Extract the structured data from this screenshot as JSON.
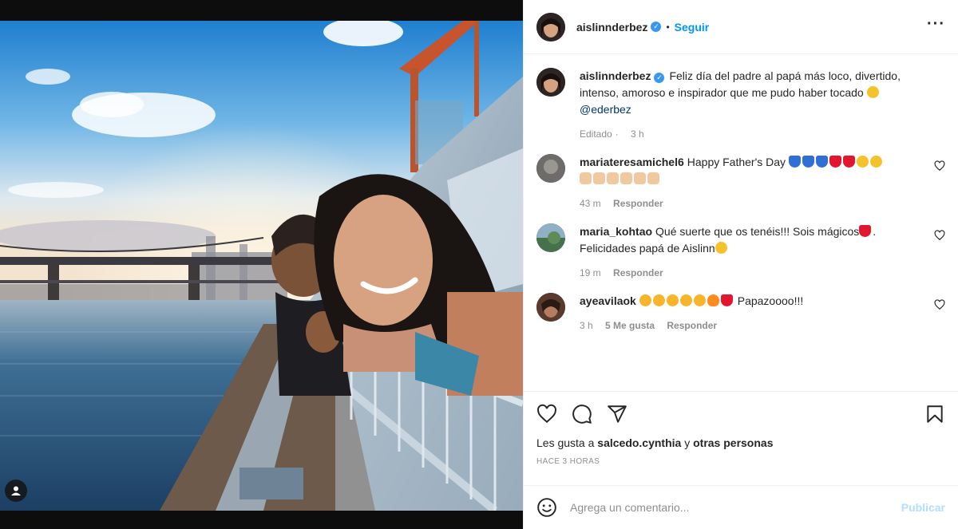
{
  "post": {
    "author": "aislinnderbez",
    "verified_icon": "verified-badge-icon",
    "separator": "•",
    "follow_label": "Seguir",
    "more_icon": "more-options-icon",
    "more_label": "···"
  },
  "caption": {
    "user": "aislinnderbez",
    "text": "Feliz día del padre al papá más loco, divertido, intenso, amoroso e inspirador que me pudo haber tocado",
    "mention": "@ederbez",
    "edited_label": "Editado",
    "time": "3 h"
  },
  "comments": [
    {
      "user": "mariateresamichel6",
      "text": "Happy Father's Day",
      "time": "43 m",
      "reply_label": "Responder"
    },
    {
      "user": "maria_kohtao",
      "text": "Qué suerte que os tenéis!!! Sois mágicos",
      "text2": ". Felicidades papá de Aislinn",
      "time": "19 m",
      "reply_label": "Responder"
    },
    {
      "user": "ayeavilaok",
      "text": "Papazoooo!!!",
      "time": "3 h",
      "likes_label": "5 Me gusta",
      "reply_label": "Responder"
    }
  ],
  "actions": {
    "like_icon": "heart-icon",
    "comment_icon": "comment-icon",
    "share_icon": "paper-plane-icon",
    "save_icon": "bookmark-icon"
  },
  "likes": {
    "prefix": "Les gusta a",
    "user": "salcedo.cynthia",
    "connector": "y",
    "others": "otras personas"
  },
  "timestamp": "HACE 3 HORAS",
  "composer": {
    "emoji_icon": "emoji-smile-icon",
    "placeholder": "Agrega un comentario...",
    "publish_label": "Publicar"
  },
  "colors": {
    "link_blue": "#0095f6",
    "publish_disabled": "#b2dffc",
    "muted": "#8e8e8e",
    "verified": "#3897f0"
  }
}
